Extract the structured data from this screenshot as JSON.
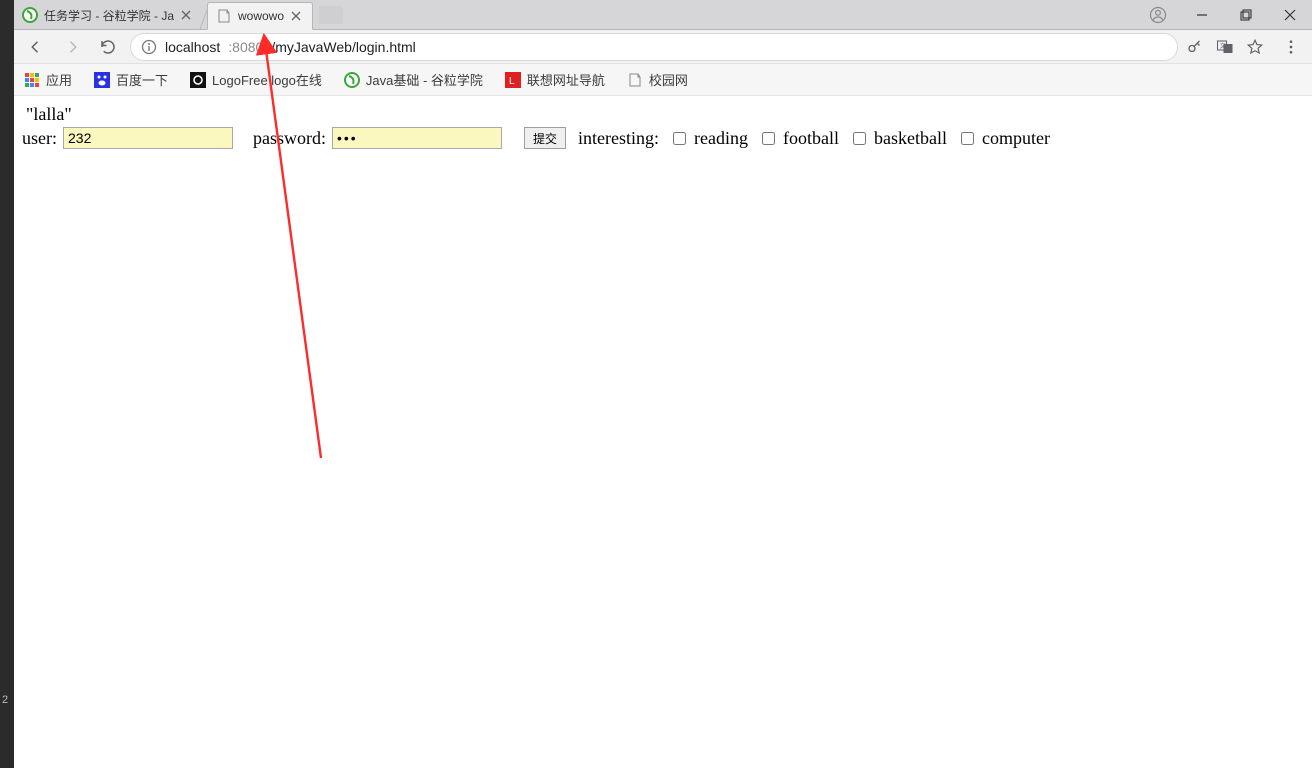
{
  "left_sliver": {
    "line_number": "2"
  },
  "tabs": [
    {
      "title": "任务学习 - 谷粒学院 - Ja",
      "active": false
    },
    {
      "title": "wowowo",
      "active": true
    }
  ],
  "address": {
    "host": "localhost",
    "port": ":8080",
    "path": "/myJavaWeb/login.html"
  },
  "bookmarks": {
    "apps": "应用",
    "items": [
      {
        "label": "百度一下"
      },
      {
        "label": "LogoFree logo在线"
      },
      {
        "label": "Java基础 - 谷粒学院"
      },
      {
        "label": "联想网址导航"
      },
      {
        "label": "校园网"
      }
    ]
  },
  "page": {
    "heading": "\"lalla\"",
    "user_label": "user:",
    "user_value": "232",
    "password_label": "password:",
    "password_value": "•••",
    "submit_label": "提交",
    "interest_label": "interesting:",
    "checkboxes": [
      "reading",
      "football",
      "basketball",
      "computer"
    ]
  }
}
